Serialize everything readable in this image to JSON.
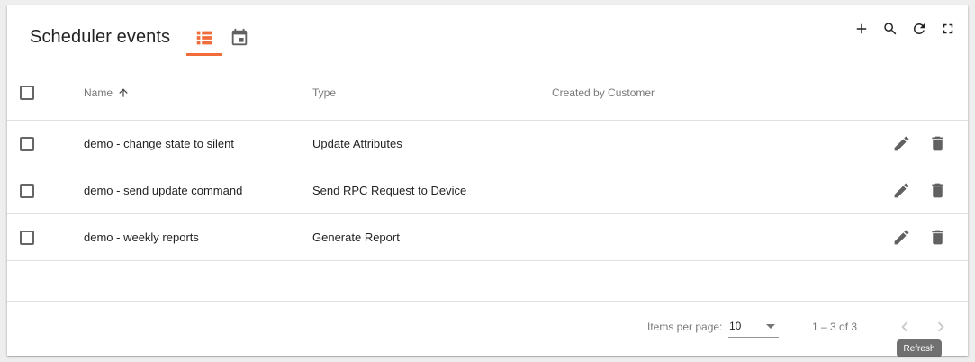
{
  "header": {
    "title": "Scheduler events",
    "view_icons": [
      "list-icon",
      "calendar-icon"
    ],
    "tools": [
      "add-icon",
      "search-icon",
      "refresh-icon",
      "fullscreen-icon"
    ]
  },
  "table": {
    "columns": {
      "name": "Name",
      "type": "Type",
      "customer": "Created by Customer"
    },
    "sort_icon": "arrow-upward-icon",
    "rows": [
      {
        "name": "demo - change state to silent",
        "type": "Update Attributes"
      },
      {
        "name": "demo - send update command",
        "type": "Send RPC Request to Device"
      },
      {
        "name": "demo - weekly reports",
        "type": "Generate Report"
      }
    ],
    "row_actions": [
      "edit-icon",
      "delete-icon"
    ]
  },
  "footer": {
    "items_per_page_label": "Items per page:",
    "items_per_page_value": "10",
    "range": "1 – 3 of 3",
    "tooltip": "Refresh"
  },
  "colors": {
    "accent": "#f26b3a",
    "icon": "#616161",
    "disabled": "#c8c8c8"
  }
}
